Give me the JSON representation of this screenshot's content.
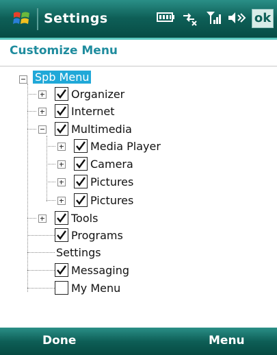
{
  "titlebar": {
    "app_title": "Settings",
    "ok_label": "ok",
    "icons": [
      "windows-start-icon",
      "battery-icon",
      "connectivity-icon",
      "signal-icon",
      "volume-icon"
    ]
  },
  "heading": "Customize Menu",
  "tree": {
    "root": "Spb Menu",
    "items": [
      {
        "label": "Organizer",
        "checked": true,
        "expander": "plus"
      },
      {
        "label": "Internet",
        "checked": true,
        "expander": "plus"
      },
      {
        "label": "Multimedia",
        "checked": true,
        "expander": "minus"
      },
      {
        "label": "Media Player",
        "checked": true,
        "expander": "plus"
      },
      {
        "label": "Camera",
        "checked": true,
        "expander": "plus"
      },
      {
        "label": "Pictures",
        "checked": true,
        "expander": "plus"
      },
      {
        "label": "Pictures",
        "checked": true,
        "expander": "plus"
      },
      {
        "label": "Tools",
        "checked": true,
        "expander": "plus"
      },
      {
        "label": "Programs",
        "checked": true,
        "expander": "none"
      },
      {
        "label": "Settings",
        "checked": null,
        "expander": "none"
      },
      {
        "label": "Messaging",
        "checked": true,
        "expander": "none"
      },
      {
        "label": "My Menu",
        "checked": false,
        "expander": "none"
      }
    ]
  },
  "softkeys": {
    "left": "Done",
    "right": "Menu"
  },
  "colors": {
    "bar": "#0e5f57",
    "heading": "#1f8c9e",
    "selection": "#20a8d8"
  }
}
